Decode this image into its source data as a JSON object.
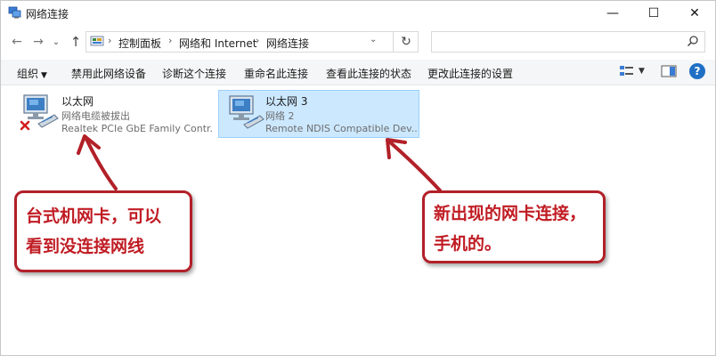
{
  "window": {
    "title": "网络连接",
    "controls": {
      "minimize": "—",
      "maximize": "☐",
      "close": "✕"
    }
  },
  "nav": {
    "back": "←",
    "forward": "→",
    "recent": "⌄",
    "up": "↑",
    "breadcrumbs": [
      "控制面板",
      "网络和 Internet",
      "网络连接"
    ],
    "separator": "›",
    "dropdown": "⌄",
    "refresh": "↻",
    "search_placeholder": ""
  },
  "commands": [
    "组织",
    "禁用此网络设备",
    "诊断这个连接",
    "重命名此连接",
    "查看此连接的状态",
    "更改此连接的设置"
  ],
  "organize_caret": "▼",
  "view_caret": "▼",
  "help": "?",
  "items": [
    {
      "name": "以太网",
      "status": "网络电缆被拔出",
      "device": "Realtek PCIe GbE Family Contr...",
      "icon": "ethernet-disconnected-icon"
    },
    {
      "name": "以太网 3",
      "status": "网络 2",
      "device": "Remote NDIS Compatible Dev...",
      "icon": "ethernet-connected-icon"
    }
  ],
  "annotations": [
    {
      "lines": [
        "台式机网卡，可以",
        "看到没连接网线"
      ]
    },
    {
      "lines": [
        "新出现的网卡连接，",
        "手机的。"
      ]
    }
  ],
  "colors": {
    "selection": "#cce8ff",
    "selection_border": "#99d1ff",
    "annotation_red": "#c01c24",
    "help_blue": "#1f6fc5"
  }
}
